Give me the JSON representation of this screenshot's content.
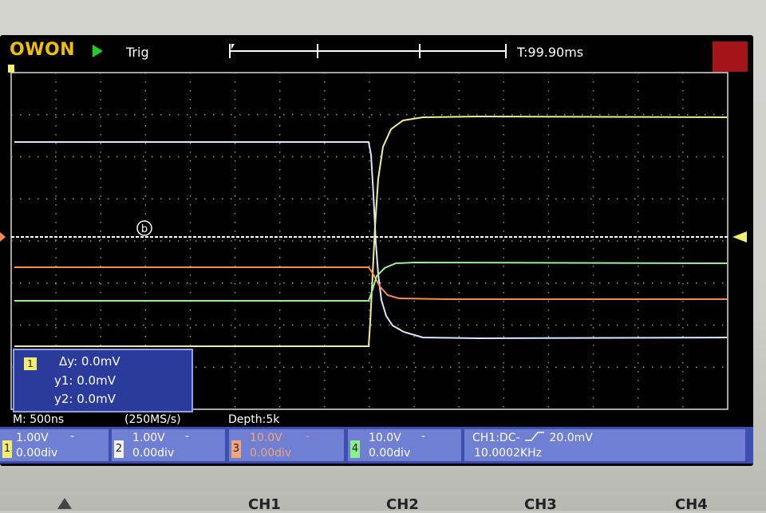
{
  "brand": "OWON",
  "header": {
    "status": "Trig",
    "time_position": "T:99.90ms"
  },
  "cursor_panel": {
    "channel": "1",
    "delta_y": "Δy: 0.0mV",
    "y1": "y1: 0.0mV",
    "y2": "y2: 0.0mV"
  },
  "center_marker": "b",
  "acquisition": {
    "timebase": "M: 500ns",
    "sample_rate": "(250MS/s)",
    "depth": "Depth:5k"
  },
  "channels": [
    {
      "num": "1",
      "scale": "1.00V",
      "offset": "0.00div",
      "coupling": "-",
      "color": "#f2ee6e",
      "text_color": "#ffffff"
    },
    {
      "num": "2",
      "scale": "1.00V",
      "offset": "0.00div",
      "coupling": "-",
      "color": "#f2f2f2",
      "text_color": "#ffffff"
    },
    {
      "num": "3",
      "scale": "10.0V",
      "offset": "0.00div",
      "coupling": "-",
      "color": "#f4a57a",
      "text_color": "#f4a57a"
    },
    {
      "num": "4",
      "scale": "10.0V",
      "offset": "0.00div",
      "coupling": "-",
      "color": "#8af08a",
      "text_color": "#ffffff"
    }
  ],
  "trigger": {
    "setting": "CH1:DC-",
    "level": "20.0mV",
    "frequency": "10.0002KHz"
  },
  "panel_buttons": [
    "CH1",
    "CH2",
    "CH3",
    "CH4"
  ],
  "trace_colors": {
    "ch1": "#f4f08a",
    "ch2": "#dce6ff",
    "ch3": "#ff8a4a",
    "ch4": "#9af09a",
    "cursor": "#ffffff"
  }
}
